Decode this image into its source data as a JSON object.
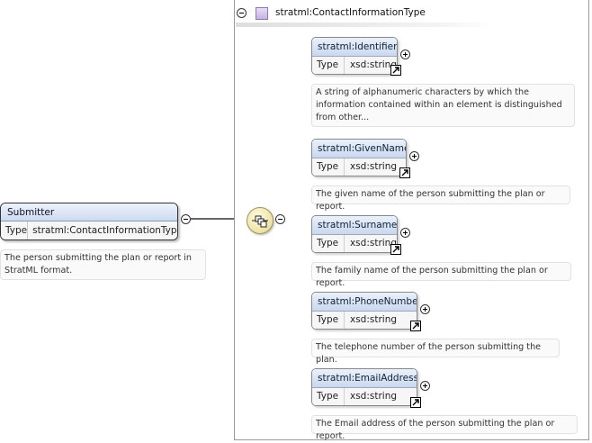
{
  "root": {
    "name": "Submitter",
    "type_key": "Type",
    "type_value": "stratml:ContactInformationType",
    "doc": "The person submitting the plan or report in StratML format."
  },
  "complex_type": {
    "name": "stratml:ContactInformationType"
  },
  "elements": [
    {
      "name": "stratml:Identifier",
      "type_key": "Type",
      "type_value": "xsd:string",
      "doc": "A string of alphanumeric characters by which the information contained within an element is distinguished from other..."
    },
    {
      "name": "stratml:GivenName",
      "type_key": "Type",
      "type_value": "xsd:string",
      "doc": "The given name of the person submitting the plan or report."
    },
    {
      "name": "stratml:Surname",
      "type_key": "Type",
      "type_value": "xsd:string",
      "doc": "The family name of the person submitting the plan or report."
    },
    {
      "name": "stratml:PhoneNumber",
      "type_key": "Type",
      "type_value": "xsd:string",
      "doc": "The telephone number of the person submitting the plan."
    },
    {
      "name": "stratml:EmailAddress",
      "type_key": "Type",
      "type_value": "xsd:string",
      "doc": "The Email address of the person submitting the plan or report."
    }
  ],
  "colors": {
    "header_gradient_top": "#eaf1fb",
    "header_gradient_bottom": "#c9d8ef",
    "sequence_fill": "#eee2a4",
    "type_icon": "#c6b2e2"
  }
}
